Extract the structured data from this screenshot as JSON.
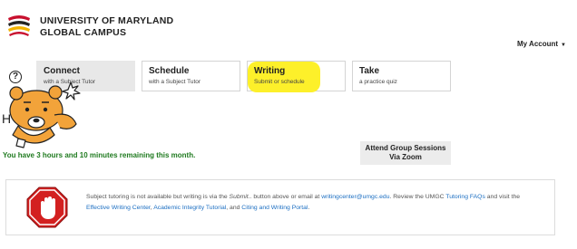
{
  "header": {
    "logo_line1": "UNIVERSITY OF MARYLAND",
    "logo_line2": "GLOBAL CAMPUS",
    "account_label": "My Account"
  },
  "tabs": [
    {
      "title": "Connect",
      "subtitle": "with a Subject Tutor",
      "active": true
    },
    {
      "title": "Schedule",
      "subtitle": "with a Subject Tutor",
      "active": false
    },
    {
      "title": "Writing",
      "subtitle": "Submit or schedule",
      "active": false,
      "highlight_color": "#fdf02a"
    },
    {
      "title": "Take",
      "subtitle": "a practice quiz",
      "active": false
    }
  ],
  "status": {
    "hours_remaining": "You have 3 hours and 10 minutes remaining this month.",
    "hours_color": "#1f7a1f"
  },
  "group_sessions": {
    "line1": "Attend Group Sessions",
    "line2": "Via Zoom"
  },
  "notice": {
    "text_1": "Subject tutoring is not available but writing is via the ",
    "text_italic": "Submit..",
    "text_2": " button above or email at ",
    "email_link": "writingcenter@umgc.edu",
    "text_3": ". Review the UMGC ",
    "link_faqs": "Tutoring FAQs",
    "text_4": " and visit the ",
    "link_writing_center": "Effective Writing Center",
    "text_5": ", ",
    "link_integrity": "Academic Integrity Tutorial",
    "text_6": ", and ",
    "link_citing": "Citing and Writing Portal",
    "text_7": ".",
    "icon": "stop-hand-icon",
    "link_color": "#1b6ec2"
  },
  "colors": {
    "brand_red": "#c8102e",
    "brand_yellow": "#f2b200",
    "stop_red": "#d32020"
  }
}
